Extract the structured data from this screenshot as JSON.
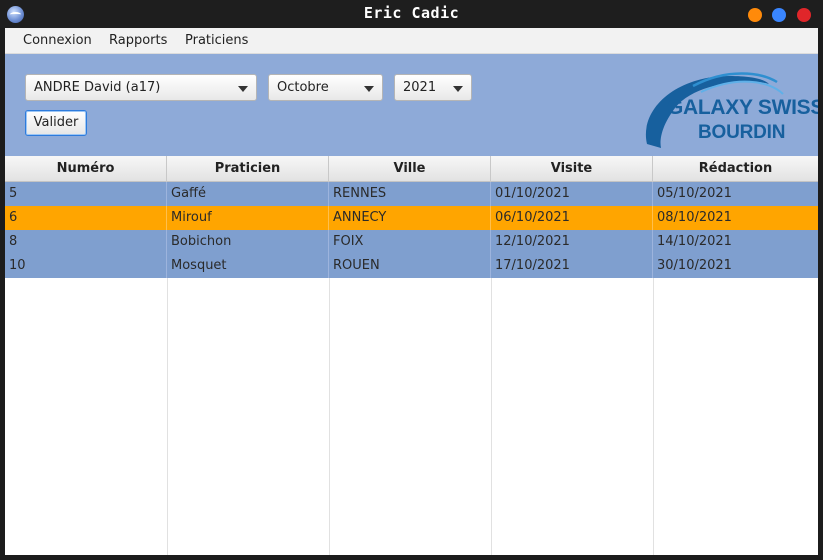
{
  "window": {
    "title": "Eric Cadic"
  },
  "menu": {
    "items": [
      "Connexion",
      "Rapports",
      "Praticiens"
    ]
  },
  "form": {
    "visiteur": "ANDRE David (a17)",
    "mois": "Octobre",
    "annee": "2021",
    "valider_label": "Valider"
  },
  "logo": {
    "line1": "GALAXY SWISS",
    "line2": "BOURDIN"
  },
  "table": {
    "headers": [
      "Numéro",
      "Praticien",
      "Ville",
      "Visite",
      "Rédaction"
    ],
    "rows": [
      [
        "5",
        "Gaffé",
        "RENNES",
        "01/10/2021",
        "05/10/2021"
      ],
      [
        "6",
        "Mirouf",
        "ANNECY",
        "06/10/2021",
        "08/10/2021"
      ],
      [
        "8",
        "Bobichon",
        "FOIX",
        "12/10/2021",
        "14/10/2021"
      ],
      [
        "10",
        "Mosquet",
        "ROUEN",
        "17/10/2021",
        "30/10/2021"
      ]
    ],
    "selected_row": 1
  },
  "colors": {
    "panel": "#8eaad8",
    "row": "#7f9fcf",
    "selected": "#ffa500",
    "logo": "#17609e"
  }
}
